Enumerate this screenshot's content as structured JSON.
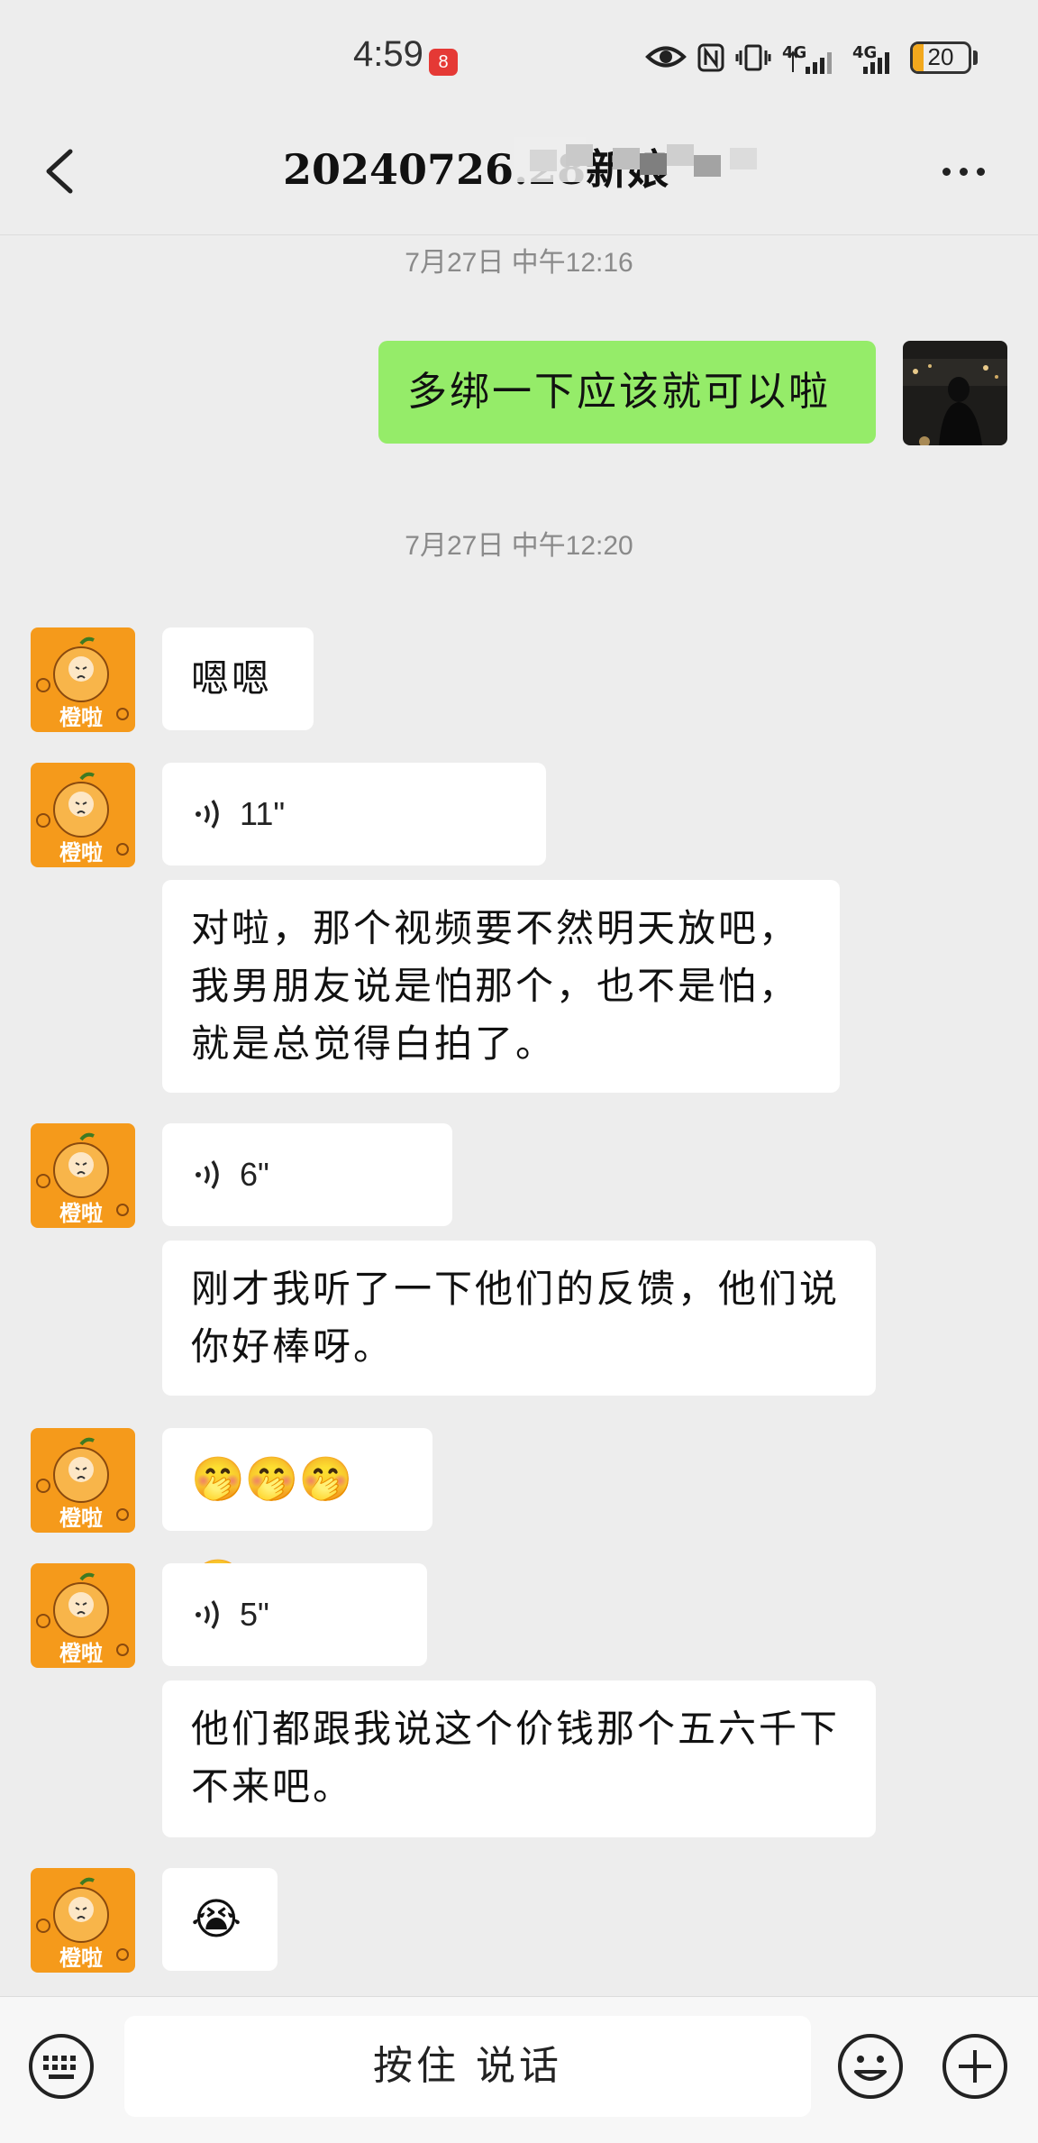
{
  "status_bar": {
    "time": "4:59",
    "notification_badge": "8",
    "signal_1": "4G",
    "signal_2": "4G",
    "battery_level": "20",
    "battery_fraction": 0.2
  },
  "header": {
    "title": "20240726.28新娘",
    "back_icon": "chevron-left-icon",
    "more_icon": "more-dots-icon"
  },
  "chat": {
    "timestamps": [
      "7月27日 中午12:16",
      "7月27日 中午12:20"
    ],
    "messages": [
      {
        "sender": "me",
        "type": "text",
        "text": "多绑一下应该就可以啦"
      },
      {
        "sender": "other",
        "type": "text",
        "text": "嗯嗯"
      },
      {
        "sender": "other",
        "type": "voice",
        "duration": "11\""
      },
      {
        "sender": "other",
        "type": "transcript",
        "text": "对啦，那个视频要不然明天放吧，我男朋友说是怕那个，也不是怕，就是总觉得白拍了。"
      },
      {
        "sender": "other",
        "type": "voice",
        "duration": "6\""
      },
      {
        "sender": "other",
        "type": "transcript",
        "text": "刚才我听了一下他们的反馈，他们说你好棒呀。"
      },
      {
        "sender": "other",
        "type": "emoji",
        "text": "🤭🤭🤭🤭"
      },
      {
        "sender": "other",
        "type": "voice",
        "duration": "5\""
      },
      {
        "sender": "other",
        "type": "transcript",
        "text": "他们都跟我说这个价钱那个五六千下不来吧。"
      },
      {
        "sender": "other",
        "type": "emoji",
        "text": "😭"
      }
    ],
    "other_avatar_label": "橙啦"
  },
  "bottom_bar": {
    "hold_to_talk": "按住 说话",
    "keyboard_icon": "keyboard-icon",
    "emoji_icon": "smiley-icon",
    "plus_icon": "plus-circle-icon"
  },
  "colors": {
    "background": "#ededed",
    "my_bubble": "#95ec69",
    "other_bubble": "#ffffff",
    "avatar_orange": "#f59a1b"
  }
}
